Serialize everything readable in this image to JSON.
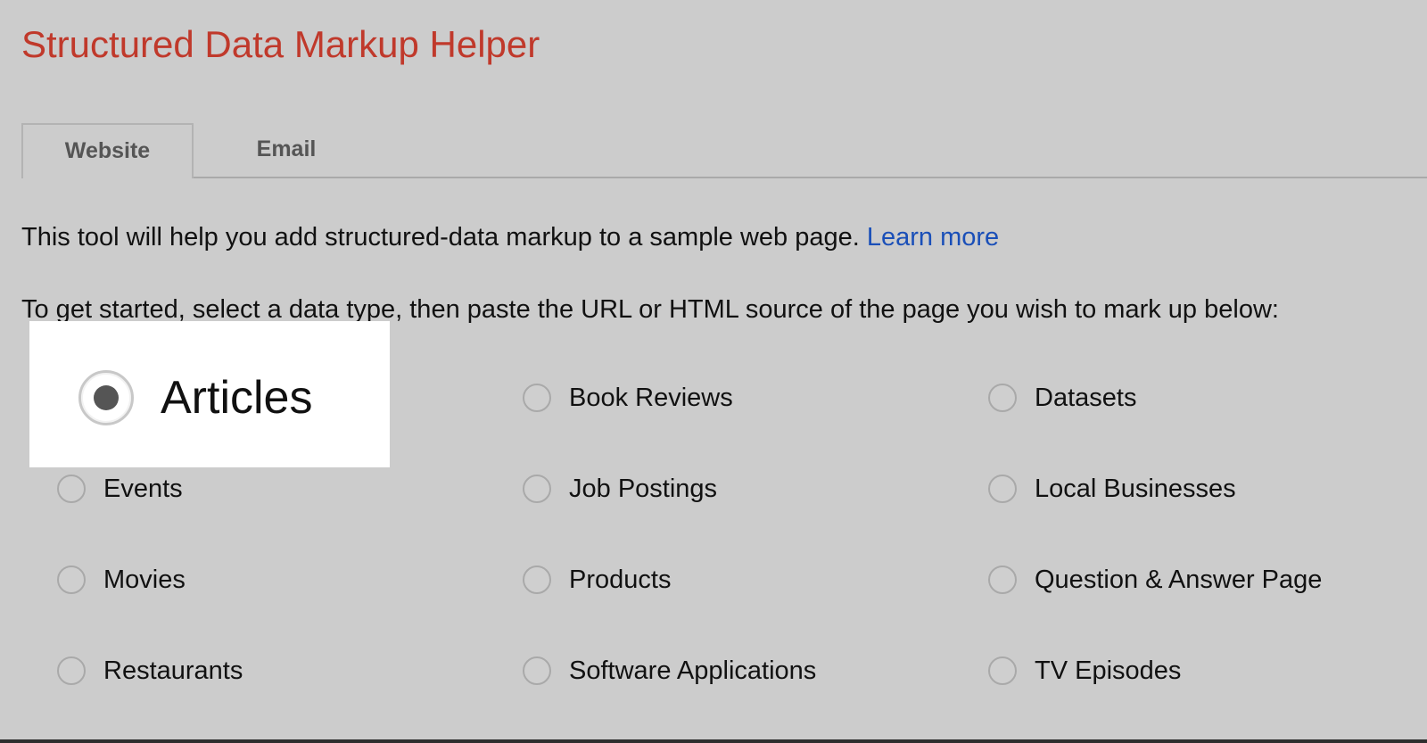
{
  "app": {
    "title": "Structured Data Markup Helper"
  },
  "tabs": [
    {
      "label": "Website",
      "active": true
    },
    {
      "label": "Email",
      "active": false
    }
  ],
  "intro": {
    "text": "This tool will help you add structured-data markup to a sample web page.",
    "link_label": "Learn more"
  },
  "instruction": "To get started, select a data type, then paste the URL or HTML source of the page you wish to mark up below:",
  "data_types": {
    "selected": "Articles",
    "options": [
      {
        "label": "Articles",
        "checked": true
      },
      {
        "label": "Book Reviews",
        "checked": false
      },
      {
        "label": "Datasets",
        "checked": false
      },
      {
        "label": "Events",
        "checked": false
      },
      {
        "label": "Job Postings",
        "checked": false
      },
      {
        "label": "Local Businesses",
        "checked": false
      },
      {
        "label": "Movies",
        "checked": false
      },
      {
        "label": "Products",
        "checked": false
      },
      {
        "label": "Question & Answer Page",
        "checked": false
      },
      {
        "label": "Restaurants",
        "checked": false
      },
      {
        "label": "Software Applications",
        "checked": false
      },
      {
        "label": "TV Episodes",
        "checked": false
      }
    ]
  },
  "colors": {
    "title": "#c0392b",
    "link": "#1a4fb8",
    "radio_dot": "#555555"
  },
  "icons": {
    "radio_selected": "radio-selected-icon",
    "radio_unselected": "radio-unselected-icon"
  }
}
